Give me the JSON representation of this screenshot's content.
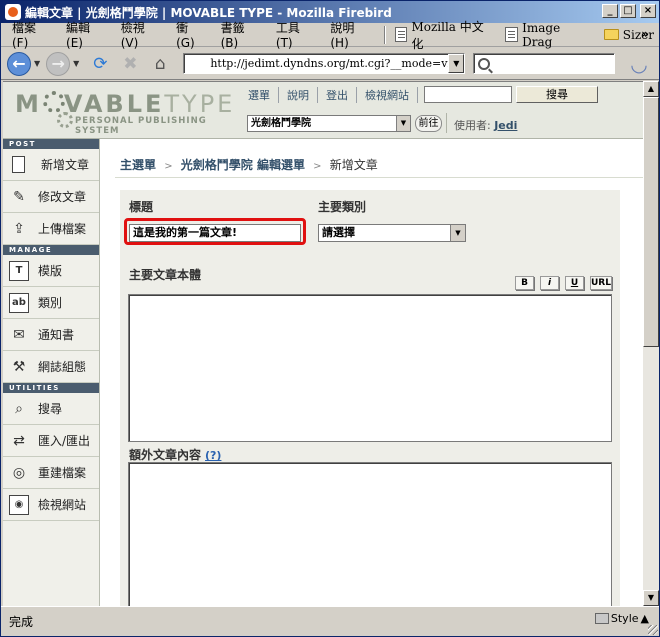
{
  "window": {
    "title": "編輯文章 | 光劍格鬥學院 | MOVABLE TYPE - Mozilla Firebird"
  },
  "menubar": {
    "items": [
      "檔案(F)",
      "編輯(E)",
      "檢視(V)",
      "衝(G)",
      "書籤(B)",
      "工具(T)",
      "說明(H)"
    ],
    "bookmarks": [
      "Mozilla 中文化",
      "Image Drag",
      "Sizer"
    ],
    "chevron": "»"
  },
  "navbar": {
    "url": "http://jedimt.dyndns.org/mt.cgi?__mode=view&_ty",
    "search_value": ""
  },
  "mt": {
    "logo_word_a": "M",
    "logo_word_b": "VABLE",
    "logo_word_c": "TYPE",
    "logo_tagline": "PERSONAL PUBLISHING SYSTEM",
    "nav": [
      "選單",
      "說明",
      "登出",
      "檢視網站"
    ],
    "search_button": "搜尋",
    "blog_select": "光劍格鬥學院",
    "go_button": "前往",
    "user_label": "使用者:",
    "user_name": "Jedi"
  },
  "sidebar": {
    "sections": [
      {
        "header": "POST",
        "items": [
          {
            "label": "新增文章",
            "icon": "new-post-icon"
          },
          {
            "label": "修改文章",
            "icon": "edit-post-icon"
          },
          {
            "label": "上傳檔案",
            "icon": "upload-icon"
          }
        ]
      },
      {
        "header": "MANAGE",
        "items": [
          {
            "label": "模版",
            "icon": "template-icon"
          },
          {
            "label": "類別",
            "icon": "category-icon"
          },
          {
            "label": "通知書",
            "icon": "notification-icon"
          },
          {
            "label": "網誌組態",
            "icon": "config-icon"
          }
        ]
      },
      {
        "header": "UTILITIES",
        "items": [
          {
            "label": "搜尋",
            "icon": "search-icon"
          },
          {
            "label": "匯入/匯出",
            "icon": "import-export-icon"
          },
          {
            "label": "重建檔案",
            "icon": "rebuild-icon"
          },
          {
            "label": "檢視網站",
            "icon": "view-site-icon"
          }
        ]
      }
    ]
  },
  "breadcrumb": {
    "items": [
      "主選單",
      "光劍格鬥學院 編輯選單"
    ],
    "current": "新增文章"
  },
  "form": {
    "title_label": "標題",
    "title_value": "這是我的第一篇文章!",
    "category_label": "主要類別",
    "category_value": "請選擇",
    "body_label": "主要文章本體",
    "format_buttons": [
      "B",
      "i",
      "U",
      "URL"
    ],
    "extended_label": "額外文章內容",
    "extended_help": "(?)"
  },
  "statusbar": {
    "text": "完成",
    "style_label": "Style"
  },
  "colors": {
    "titlebar_start": "#0a246a",
    "highlight_border": "#e01010",
    "sidebar_header": "#4a5c6e",
    "link": "#33506a"
  }
}
